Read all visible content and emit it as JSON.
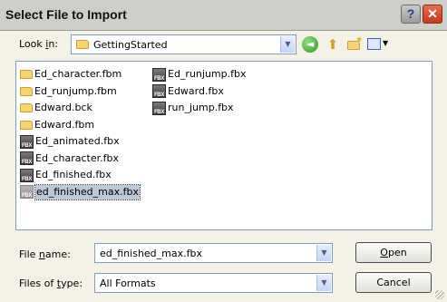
{
  "window": {
    "title": "Select File to Import",
    "help_glyph": "?",
    "close_glyph": "✕"
  },
  "lookin": {
    "label_prefix": "Look ",
    "label_accel": "i",
    "label_suffix": "n:",
    "value": "GettingStarted"
  },
  "toolbar_icons": [
    "back-icon",
    "up-folder-icon",
    "new-folder-icon",
    "views-menu-icon"
  ],
  "files": [
    {
      "name": "Ed_character.fbm",
      "type": "folder"
    },
    {
      "name": "Ed_runjump.fbm",
      "type": "folder"
    },
    {
      "name": "Edward.bck",
      "type": "folder"
    },
    {
      "name": "Edward.fbm",
      "type": "folder"
    },
    {
      "name": "Ed_animated.fbx",
      "type": "fbx"
    },
    {
      "name": "Ed_character.fbx",
      "type": "fbx"
    },
    {
      "name": "Ed_finished.fbx",
      "type": "fbx"
    },
    {
      "name": "ed_finished_max.fbx",
      "type": "fbx",
      "selected": true
    },
    {
      "name": "Ed_runjump.fbx",
      "type": "fbx"
    },
    {
      "name": "Edward.fbx",
      "type": "fbx"
    },
    {
      "name": "run_jump.fbx",
      "type": "fbx"
    }
  ],
  "fbx_icon_text": "FBX",
  "filename": {
    "label_prefix": "File ",
    "label_accel": "n",
    "label_suffix": "ame:",
    "value": "ed_finished_max.fbx"
  },
  "filetype": {
    "label_prefix": "Files of ",
    "label_accel": "t",
    "label_suffix": "ype:",
    "value": "All Formats"
  },
  "buttons": {
    "open_accel": "O",
    "open_rest": "pen",
    "cancel": "Cancel"
  },
  "colors": {
    "selection": "#bcc7d8",
    "close_red": "#c23a1b",
    "border_blue": "#7f9db9"
  }
}
